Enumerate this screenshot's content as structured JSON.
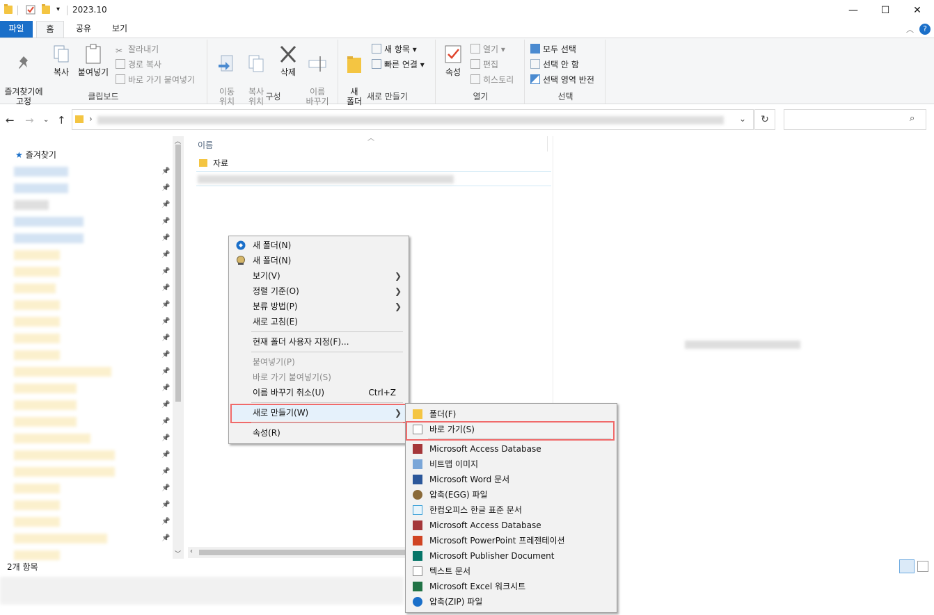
{
  "window": {
    "title": "2023.10",
    "controls": {
      "minimize": "—",
      "maximize": "☐",
      "close": "✕"
    }
  },
  "tabs": [
    {
      "label": "파일"
    },
    {
      "label": "홈"
    },
    {
      "label": "공유"
    },
    {
      "label": "보기"
    }
  ],
  "ribbon": {
    "clipboard": {
      "label": "클립보드",
      "pin": "즐겨찾기에\n고정",
      "copy": "복사",
      "paste": "붙여넣기",
      "cut": "잘라내기",
      "copy_path": "경로 복사",
      "paste_shortcut": "바로 가기 붙여넣기"
    },
    "organize": {
      "label": "구성",
      "move_to": "이동\n위치",
      "copy_to": "복사\n위치",
      "delete": "삭제",
      "rename": "이름\n바꾸기"
    },
    "new": {
      "label": "새로 만들기",
      "new_folder": "새\n폴더",
      "new_item": "새 항목",
      "easy_access": "빠른 연결"
    },
    "open": {
      "label": "열기",
      "properties": "속성",
      "open": "열기",
      "edit": "편집",
      "history": "히스토리"
    },
    "select": {
      "label": "선택",
      "select_all": "모두 선택",
      "select_none": "선택 안 함",
      "invert": "선택 영역 반전"
    }
  },
  "navpane": {
    "favorites": "즐겨찾기"
  },
  "filelist": {
    "column_name": "이름",
    "items": [
      "자료"
    ]
  },
  "status": {
    "count": "2개 항목"
  },
  "context_menu": {
    "items": [
      {
        "label": "새 폴더(N)",
        "icon": "shield-icon"
      },
      {
        "label": "새 폴더(N)",
        "icon": "tool-icon"
      },
      {
        "label": "보기(V)",
        "submenu": "❯"
      },
      {
        "label": "정렬 기준(O)",
        "submenu": "❯"
      },
      {
        "label": "분류 방법(P)",
        "submenu": "❯"
      },
      {
        "label": "새로 고침(E)"
      },
      {
        "label": "현재 폴더 사용자 지정(F)..."
      },
      {
        "label": "붙여넣기(P)",
        "disabled": true
      },
      {
        "label": "바로 가기 붙여넣기(S)",
        "disabled": true
      },
      {
        "label": "이름 바꾸기 취소(U)",
        "shortcut": "Ctrl+Z"
      },
      {
        "label": "새로 만들기(W)",
        "submenu": "❯"
      },
      {
        "label": "속성(R)"
      }
    ]
  },
  "new_submenu": {
    "items": [
      {
        "label": "폴더(F)",
        "icon": "folder-icon"
      },
      {
        "label": "바로 가기(S)",
        "icon": "shortcut-icon"
      },
      {
        "label": "Microsoft Access Database",
        "icon": "access-icon"
      },
      {
        "label": "비트맵 이미지",
        "icon": "bitmap-icon"
      },
      {
        "label": "Microsoft Word 문서",
        "icon": "word-icon"
      },
      {
        "label": "압축(EGG) 파일",
        "icon": "egg-icon"
      },
      {
        "label": "한컴오피스 한글 표준 문서",
        "icon": "hwp-icon"
      },
      {
        "label": "Microsoft Access Database",
        "icon": "access-icon"
      },
      {
        "label": "Microsoft PowerPoint 프레젠테이션",
        "icon": "powerpoint-icon"
      },
      {
        "label": "Microsoft Publisher Document",
        "icon": "publisher-icon"
      },
      {
        "label": "텍스트 문서",
        "icon": "text-icon"
      },
      {
        "label": "Microsoft Excel 워크시트",
        "icon": "excel-icon"
      },
      {
        "label": "압축(ZIP) 파일",
        "icon": "zip-icon"
      }
    ]
  },
  "colors": {
    "accent": "#1a6fc9",
    "highlight_border": "#f06a6a",
    "folder": "#f4c542"
  }
}
